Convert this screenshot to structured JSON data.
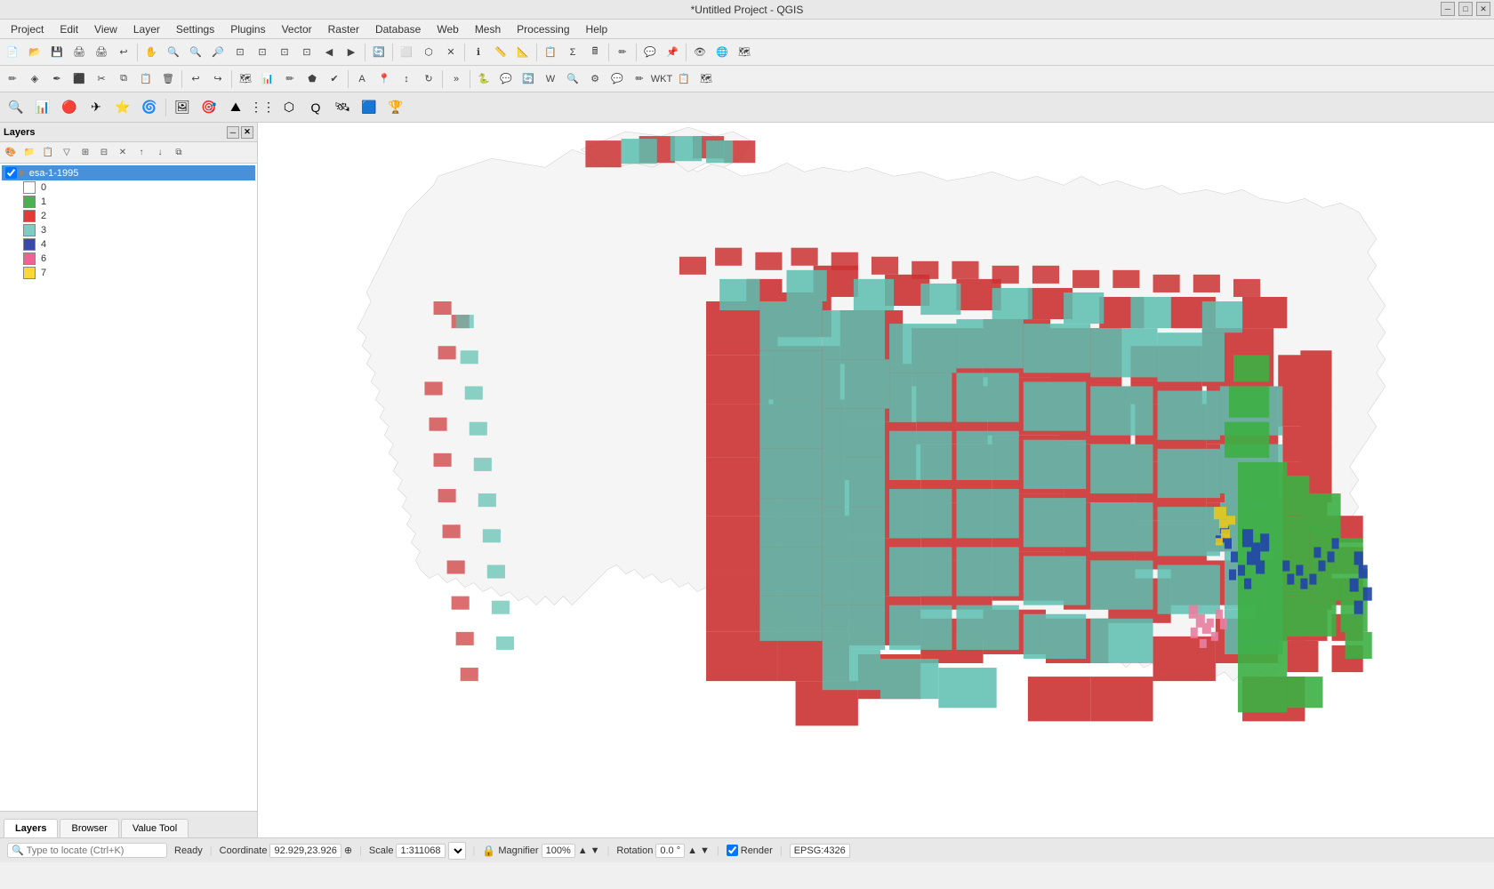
{
  "titlebar": {
    "title": "*Untitled Project - QGIS",
    "min_label": "─",
    "max_label": "□",
    "close_label": "✕"
  },
  "menubar": {
    "items": [
      "Project",
      "Edit",
      "View",
      "Layer",
      "Settings",
      "Plugins",
      "Vector",
      "Raster",
      "Database",
      "Web",
      "Mesh",
      "Processing",
      "Help"
    ]
  },
  "layers_panel": {
    "title": "Layers",
    "layer_name": "esa-1-1995",
    "legend": [
      {
        "label": "0",
        "color": "transparent"
      },
      {
        "label": "1",
        "color": "#4CAF50"
      },
      {
        "label": "2",
        "color": "#e53935"
      },
      {
        "label": "3",
        "color": "#80CBC4"
      },
      {
        "label": "4",
        "color": "#3949AB"
      },
      {
        "label": "6",
        "color": "#F06292"
      },
      {
        "label": "7",
        "color": "#FDD835"
      }
    ]
  },
  "bottom_tabs": {
    "tabs": [
      "Layers",
      "Browser",
      "Value Tool"
    ]
  },
  "statusbar": {
    "locate_placeholder": "Type to locate (Ctrl+K)",
    "ready_text": "Ready",
    "coordinate_label": "Coordinate",
    "coordinate_value": "92.929,23.926",
    "scale_label": "Scale",
    "scale_value": "1:311068",
    "magnifier_label": "Magnifier",
    "magnifier_value": "100%",
    "rotation_label": "Rotation",
    "rotation_value": "0.0 °",
    "render_label": "Render",
    "epsg_value": "EPSG:4326"
  },
  "map": {
    "background": "#ffffff"
  }
}
